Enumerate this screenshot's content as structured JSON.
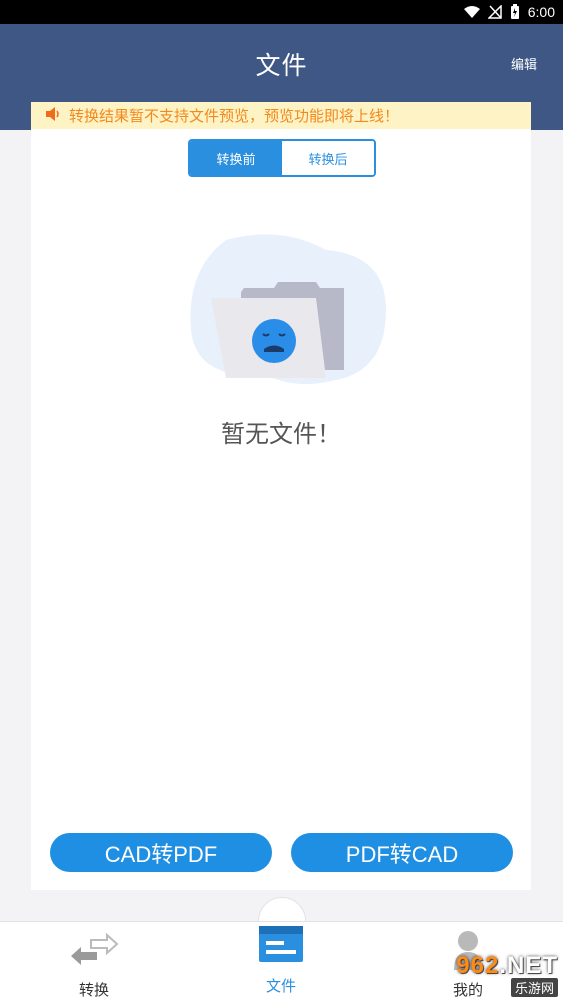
{
  "status_bar": {
    "time": "6:00",
    "icons": [
      "wifi-icon",
      "signal-icon",
      "battery-icon"
    ]
  },
  "header": {
    "title": "文件",
    "edit_label": "编辑"
  },
  "notice": {
    "icon": "speaker-icon",
    "text": "转换结果暂不支持文件预览，预览功能即将上线！"
  },
  "tabs": [
    {
      "label": "转换前",
      "active": true
    },
    {
      "label": "转换后",
      "active": false
    }
  ],
  "empty_state": {
    "illustration": "sad-folder-icon",
    "text": "暂无文件！"
  },
  "actions": {
    "cad_to_pdf": "CAD转PDF",
    "pdf_to_cad": "PDF转CAD"
  },
  "bottom_nav": [
    {
      "label": "转换",
      "icon": "convert-arrows-icon",
      "active": false
    },
    {
      "label": "文件",
      "icon": "file-list-icon",
      "active": true
    },
    {
      "label": "我的",
      "icon": "user-icon",
      "active": false
    }
  ],
  "watermark": {
    "top_num": "962",
    "top_suffix": ".NET",
    "bottom": "乐游网"
  },
  "colors": {
    "header": "#3e5784",
    "accent": "#2b8fe0",
    "notice_bg": "#fdf3c4",
    "notice_text": "#f2891e"
  }
}
